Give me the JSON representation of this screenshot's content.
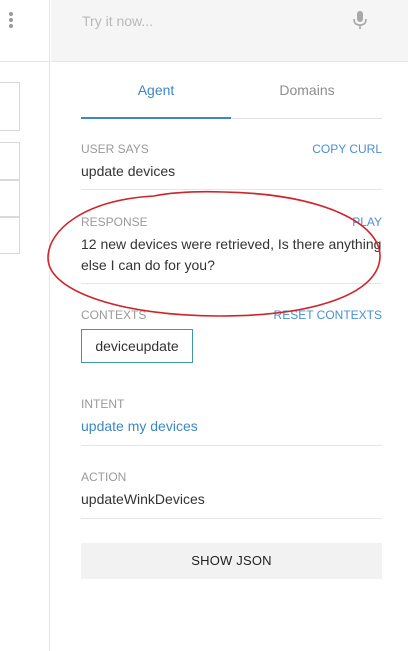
{
  "try_bar": {
    "placeholder": "Try it now..."
  },
  "tabs": [
    {
      "label": "Agent"
    },
    {
      "label": "Domains"
    }
  ],
  "user_says": {
    "label": "USER SAYS",
    "link": "COPY CURL",
    "value": "update devices"
  },
  "response": {
    "label": "RESPONSE",
    "link": "PLAY",
    "line1": "12 new devices were retrieved, Is there anything",
    "line2": "else I can do for you?"
  },
  "contexts": {
    "label": "CONTEXTS",
    "link": "RESET CONTEXTS",
    "chip": "deviceupdate"
  },
  "intent": {
    "label": "INTENT",
    "value": "update my devices"
  },
  "action": {
    "label": "ACTION",
    "value": "updateWinkDevices"
  },
  "show_json_label": "SHOW JSON",
  "colors": {
    "accent": "#3d87c5",
    "annotation": "#d0242b",
    "chip_border": "#3b9ba3"
  },
  "icons": {
    "menu": "kebab-menu-icon",
    "mic": "microphone-icon"
  }
}
